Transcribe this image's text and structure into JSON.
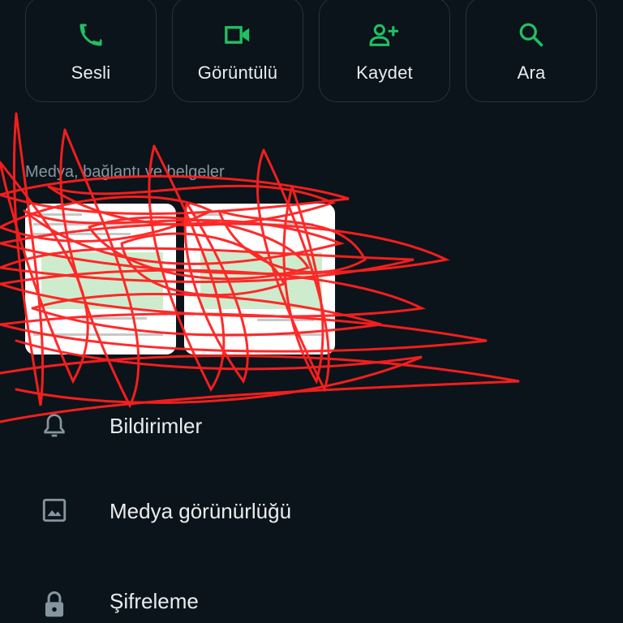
{
  "actions": [
    {
      "label": "Sesli",
      "icon": "phone-icon"
    },
    {
      "label": "Görüntülü",
      "icon": "video-icon"
    },
    {
      "label": "Kaydet",
      "icon": "add-person-icon"
    },
    {
      "label": "Ara",
      "icon": "search-icon"
    }
  ],
  "media": {
    "title": "Medya, bağlantı ve belgeler"
  },
  "menu": [
    {
      "label": "Bildirimler",
      "icon": "bell-icon"
    },
    {
      "label": "Medya görünürlüğü",
      "icon": "image-icon"
    },
    {
      "label": "Şifreleme",
      "icon": "lock-icon"
    }
  ],
  "colors": {
    "background": "#0b141a",
    "accent": "#21c063",
    "text": "#e9edef",
    "muted": "#8696a0",
    "scribble": "#ff2020"
  }
}
